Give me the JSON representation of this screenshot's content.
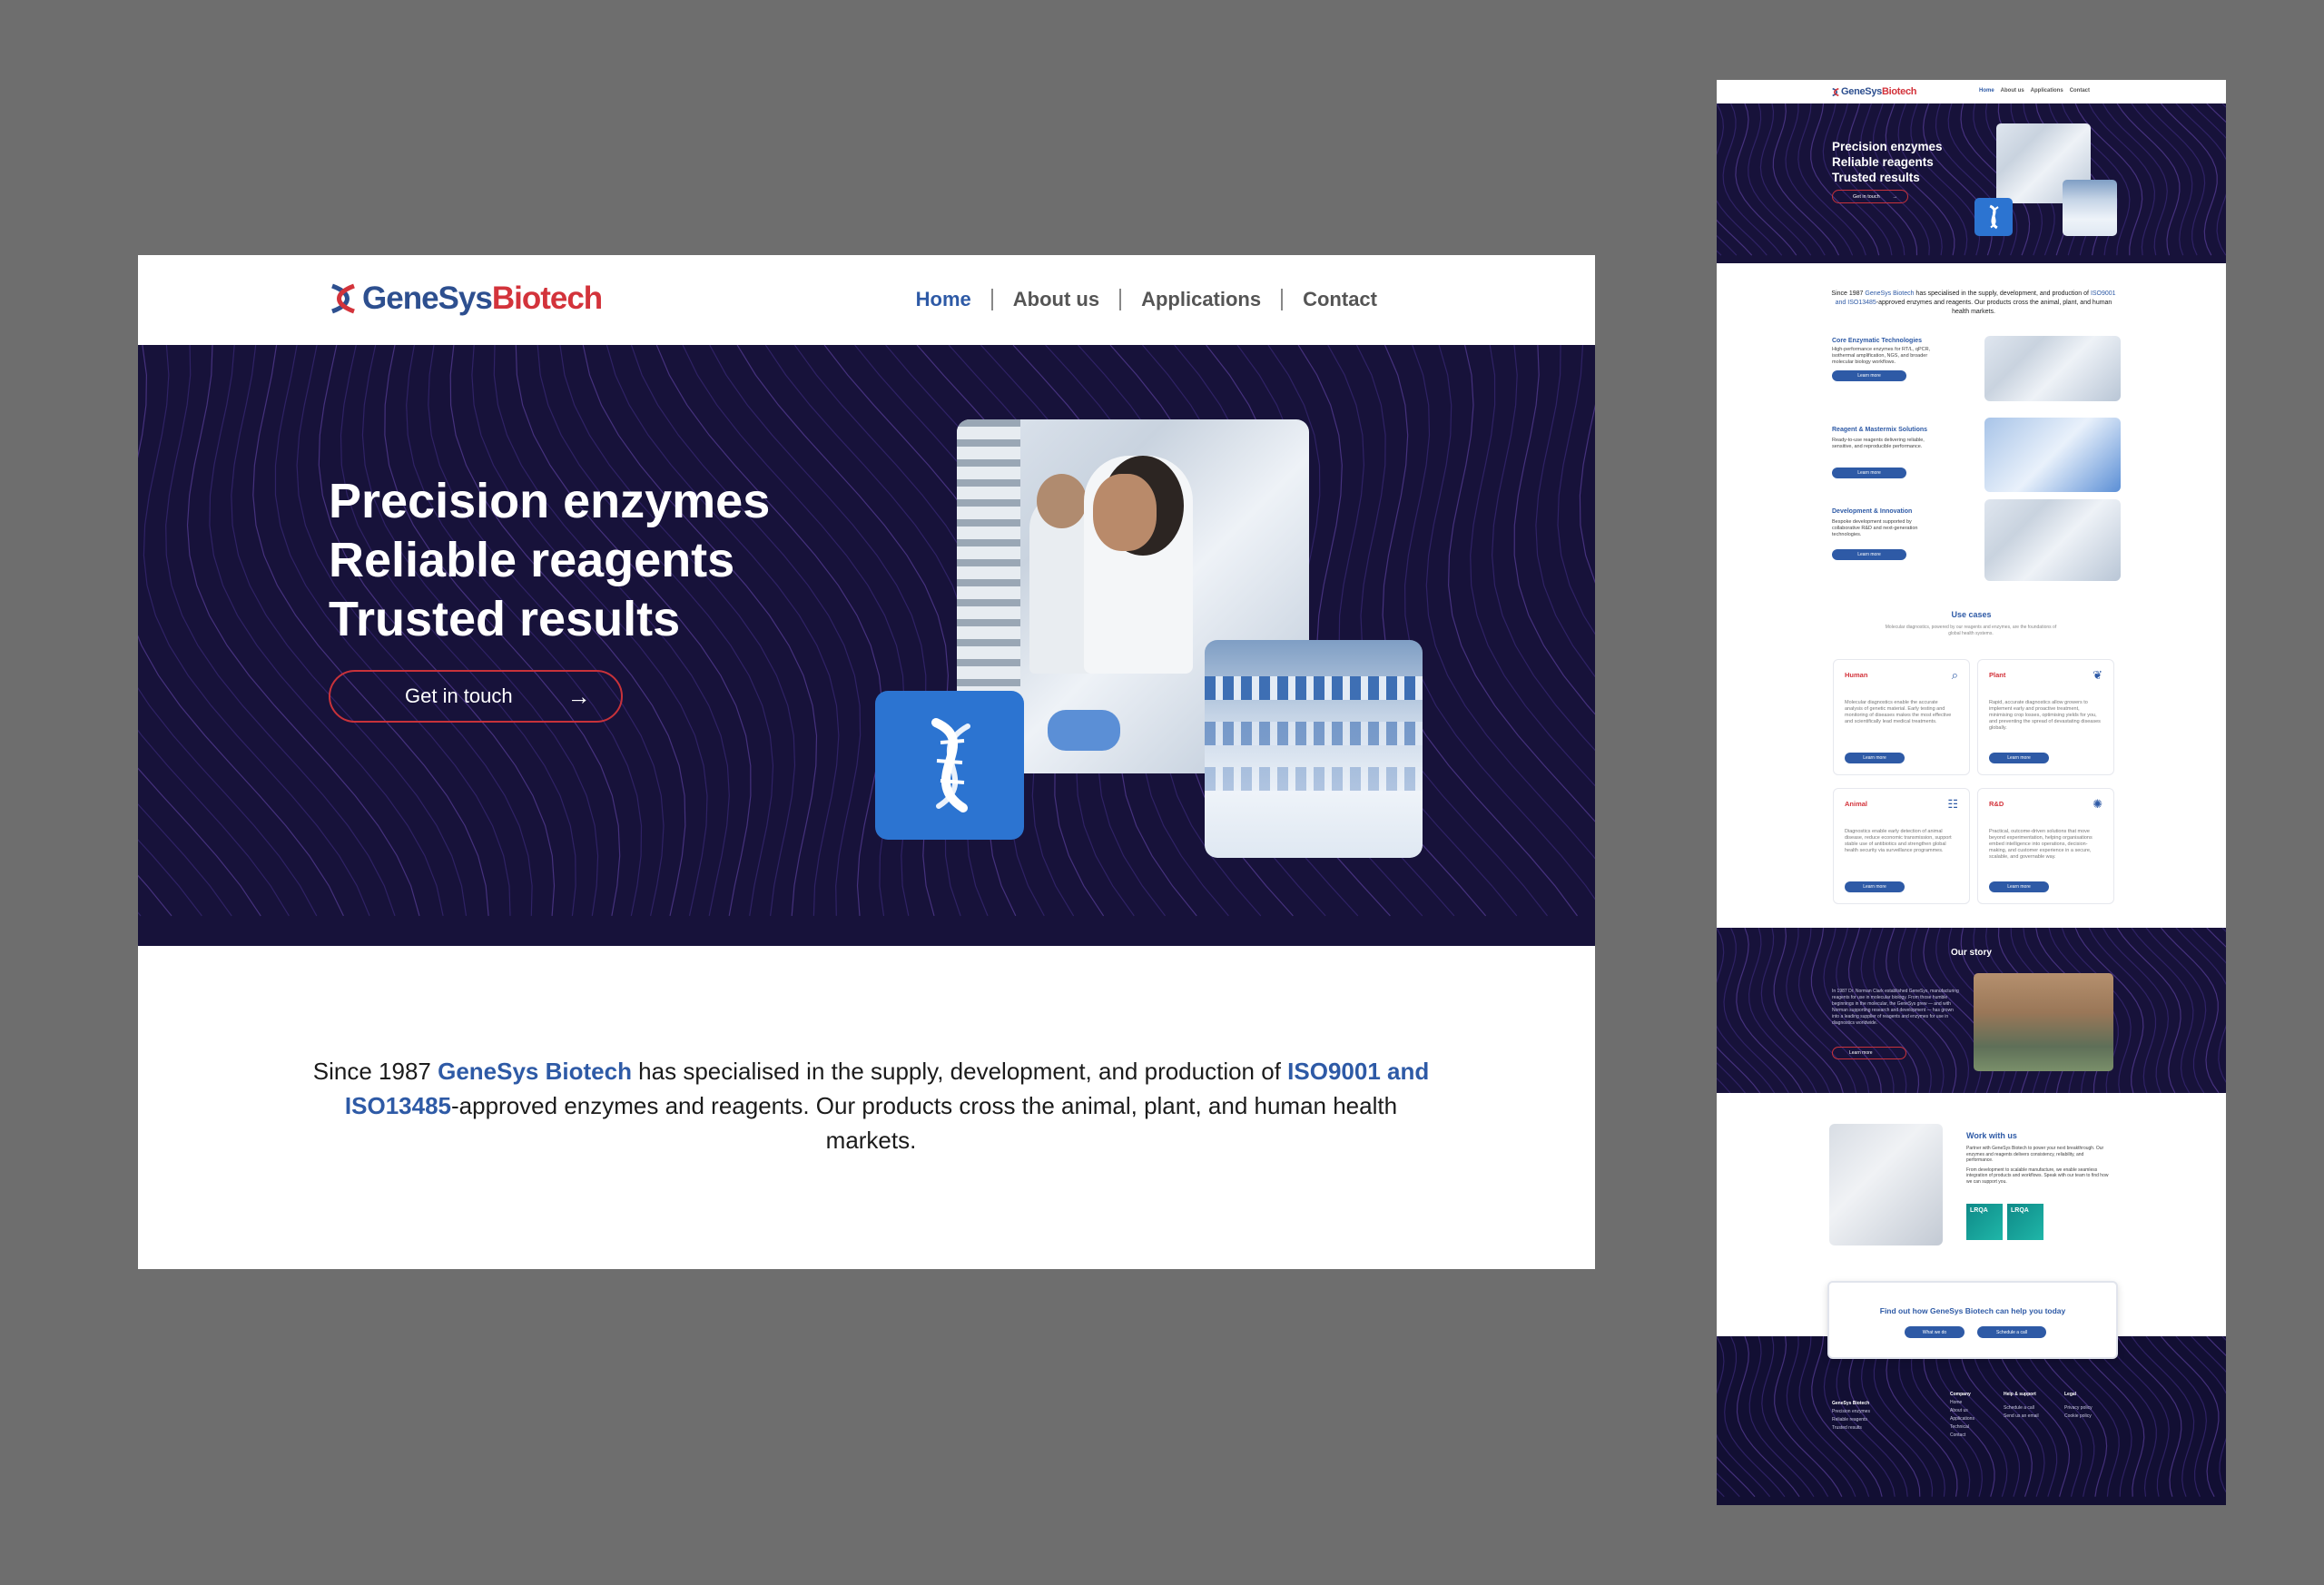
{
  "desktop": {
    "logo": {
      "part1": "GeneSys",
      "part2": "Biotech"
    },
    "nav": {
      "home": "Home",
      "about": "About us",
      "applications": "Applications",
      "contact": "Contact"
    },
    "hero": {
      "line1": "Precision enzymes",
      "line2": "Reliable reagents",
      "line3": "Trusted results",
      "cta": "Get in touch",
      "cta_arrow": "→"
    },
    "intro": {
      "pre": "Since 1987 ",
      "brand": "GeneSys Biotech",
      "mid": " has specialised in the supply, development, and production of ",
      "standards": "ISO9001 and ISO13485",
      "post": "-approved enzymes and reagents. Our products cross the animal, plant, and human health markets."
    }
  },
  "mobile": {
    "logo": {
      "part1": "GeneSys",
      "part2": "Biotech"
    },
    "nav": {
      "home": "Home",
      "about": "About us",
      "applications": "Applications",
      "contact": "Contact"
    },
    "hero": {
      "line1": "Precision enzymes",
      "line2": "Reliable reagents",
      "line3": "Trusted results",
      "cta": "Get in touch",
      "cta_arrow": "→"
    },
    "intro": {
      "pre": "Since 1987 ",
      "brand": "GeneSys Biotech",
      "mid": " has specialised in the supply, development, and production of ",
      "standards": "ISO9001 and ISO13485",
      "post": "-approved enzymes and reagents. Our products cross the animal, plant, and human health markets."
    },
    "solutions": [
      {
        "title": "Core Enzymatic Technologies",
        "desc": "High-performance enzymes for RT/L, qPCR, isothermal amplification, NGS, and broader molecular biology workflows.",
        "button": "Learn more"
      },
      {
        "title": "Reagent & Mastermix Solutions",
        "desc": "Ready-to-use reagents delivering reliable, sensitive, and reproducible performance.",
        "button": "Learn more"
      },
      {
        "title": "Development & Innovation",
        "desc": "Bespoke development supported by collaborative R&D and next-generation technologies.",
        "button": "Learn more"
      }
    ],
    "use_cases": {
      "title": "Use cases",
      "subtitle": "Molecular diagnostics, powered by our reagents and enzymes, are the foundations of global health systems.",
      "items": [
        {
          "title": "Human",
          "icon": "⌕",
          "desc": "Molecular diagnostics enable the accurate analysis of genetic material. Early testing and monitoring of diseases makes the most effective and scientifically lead medical treatments.",
          "button": "Learn more"
        },
        {
          "title": "Plant",
          "icon": "❦",
          "desc": "Rapid, accurate diagnostics allow growers to implement early and proactive treatment, minimising crop losses, optimising yields for you, and preventing the spread of devastating diseases globally.",
          "button": "Learn more"
        },
        {
          "title": "Animal",
          "icon": "☷",
          "desc": "Diagnostics enable early detection of animal disease, reduce economic transmission, support stable use of antibiotics and strengthen global health security via surveillance programmes.",
          "button": "Learn more"
        },
        {
          "title": "R&D",
          "icon": "✺",
          "desc": "Practical, outcome-driven solutions that move beyond experimentation, helping organisations embed intelligence into operations, decision-making, and customer experience in a secure, scalable, and governable way.",
          "button": "Learn more"
        }
      ]
    },
    "story": {
      "title": "Our story",
      "desc": "In 1987 Dr. Norman Clark established GeneSys, manufacturing reagents for use in molecular biology. From those humble beginnings in the molecular, the GeneSys grew — and with Norman supporting research and development — has grown into a leading supplier of reagents and enzymes for use in diagnostics worldwide.",
      "button": "Learn more"
    },
    "work": {
      "title": "Work with us",
      "desc1": "Partner with GeneSys Biotech to power your next breakthrough. Our enzymes and reagents delivers consistency, reliability, and performance.",
      "desc2": "From development to scalable manufacture, we enable seamless integration of products and workflows. Speak with our team to find how we can support you.",
      "badge1": "LRQA",
      "badge2": "LRQA"
    },
    "cta_box": {
      "title": "Find out how GeneSys Biotech can help you today",
      "button1": "What we do",
      "button2": "Schedule a call"
    },
    "footer": {
      "brand": "GeneSys Biotech",
      "tagline": [
        "Precision enzymes",
        "Reliable reagents",
        "Trusted results"
      ],
      "company": {
        "heading": "Company",
        "links": [
          "Home",
          "About us",
          "Applications",
          "Technical",
          "Contact"
        ]
      },
      "help": {
        "heading": "Help & support",
        "links": [
          "Schedule a call",
          "Send us an email"
        ]
      },
      "legal": {
        "heading": "Legal",
        "links": [
          "Privacy policy",
          "Cookie policy"
        ]
      }
    }
  },
  "colors": {
    "brand_blue": "#2e5aa6",
    "brand_red": "#d3333b",
    "hero_bg": "#17123a",
    "icon_blue": "#2c74d1"
  },
  "icons": {
    "logo": "dna-helix-icon",
    "cta": "arrow-right-icon"
  }
}
